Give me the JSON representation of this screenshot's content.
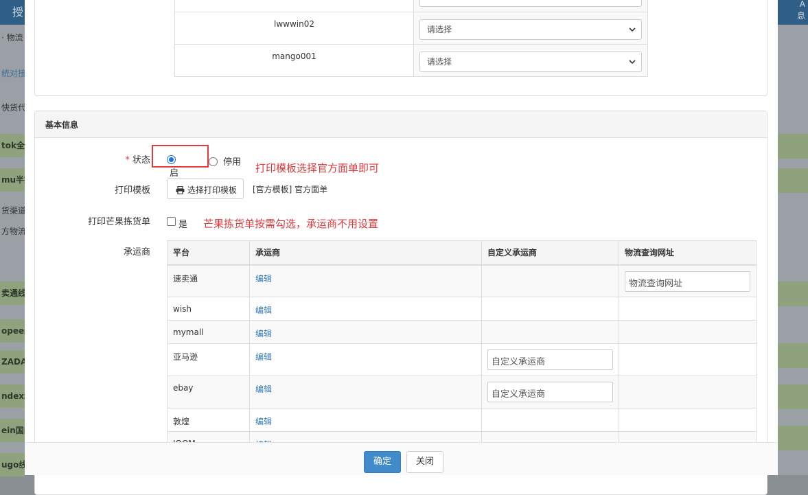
{
  "background": {
    "title_fragment": "授",
    "right_fragment_top": "A",
    "right_fragment_bottom": "息",
    "breadcrumb_fragment": "· 物流",
    "left_items": [
      {
        "text": "统对接",
        "style": "blue"
      },
      {
        "text": "快货代",
        "style": "plain"
      },
      {
        "text": "tok全托",
        "style": "green"
      },
      {
        "text": "mu半托",
        "style": "green"
      },
      {
        "text": "货渠道",
        "style": "plain"
      },
      {
        "text": "方物流",
        "style": "plain"
      },
      {
        "text": "卖通线上",
        "style": "green"
      },
      {
        "text": "opee线",
        "style": "green"
      },
      {
        "text": "ZADA",
        "style": "green"
      },
      {
        "text": "ndex线",
        "style": "green"
      },
      {
        "text": "ein国内",
        "style": "green"
      },
      {
        "text": "ugo线",
        "style": "green"
      }
    ]
  },
  "accounts": [
    {
      "name": "",
      "placeholder": ""
    },
    {
      "name": "lwwwin02",
      "placeholder": "请选择"
    },
    {
      "name": "mango001",
      "placeholder": "请选择"
    }
  ],
  "basic_info": {
    "heading": "基本信息",
    "status": {
      "required_mark": "*",
      "label": "状态",
      "options": [
        "启用",
        "停用"
      ],
      "selected": "启用"
    },
    "template": {
      "label": "打印模板",
      "button": "选择打印模板",
      "value": "[官方模板] 官方面单"
    },
    "picking": {
      "label": "打印芒果拣货单",
      "checkbox_label": "是",
      "checked": false
    },
    "carrier_label": "承运商"
  },
  "annotations": {
    "note1": "打印模板选择官方面单即可",
    "note2": "芒果拣货单按需勾选，承运商不用设置"
  },
  "carrier_table": {
    "headers": [
      "平台",
      "承运商",
      "自定义承运商",
      "物流查询网址"
    ],
    "rows": [
      {
        "platform": "速卖通",
        "action": "编辑",
        "custom": "",
        "url": "物流查询网址"
      },
      {
        "platform": "wish",
        "action": "编辑",
        "custom": "",
        "url": ""
      },
      {
        "platform": "mymall",
        "action": "编辑",
        "custom": "",
        "url": ""
      },
      {
        "platform": "亚马逊",
        "action": "编辑",
        "custom": "自定义承运商",
        "url": ""
      },
      {
        "platform": "ebay",
        "action": "编辑",
        "custom": "自定义承运商",
        "url": ""
      },
      {
        "platform": "敦煌",
        "action": "编辑",
        "custom": "",
        "url": ""
      },
      {
        "platform": "JOOM",
        "action": "编辑",
        "custom": "",
        "url": ""
      }
    ]
  },
  "footer": {
    "confirm": "确定",
    "close": "关闭"
  },
  "colors": {
    "primary": "#428bca",
    "link": "#337ab7",
    "annotation": "#e4393c",
    "header_bar": "#2f5f86"
  }
}
